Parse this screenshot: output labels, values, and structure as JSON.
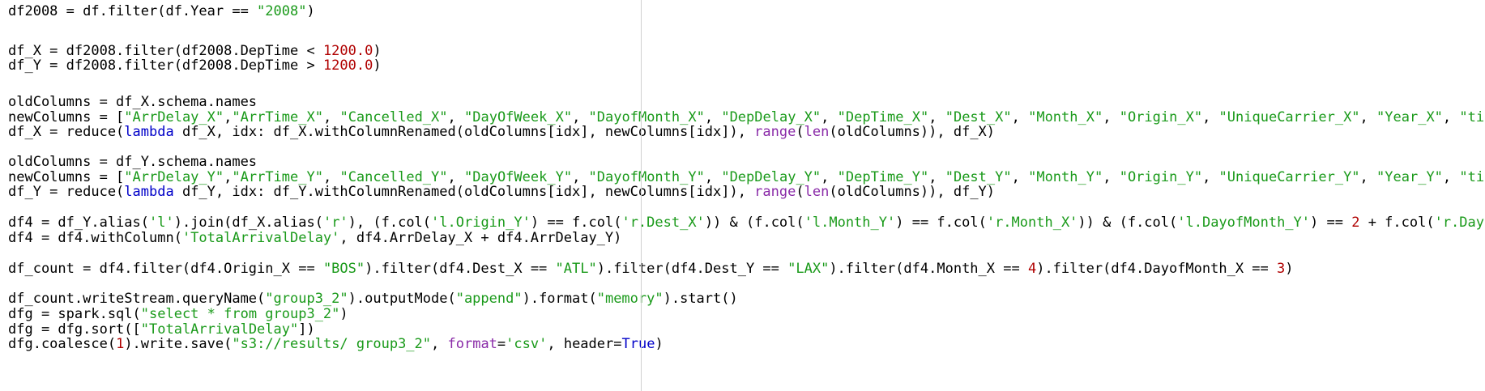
{
  "colors": {
    "plain": "#000000",
    "string": "#1a9a1a",
    "number": "#b00000",
    "keyword": "#0000c8",
    "builtin": "#8a2ba8",
    "background": "#ffffff"
  },
  "lines": [
    {
      "t": [
        [
          "df2008 = df.filter(df.Year == ",
          "plain"
        ],
        [
          "\"2008\"",
          "string"
        ],
        [
          ")",
          "plain"
        ]
      ]
    },
    {
      "t": []
    },
    {
      "t": [
        [
          "df_X = df2008.filter(df2008.DepTime < ",
          "plain"
        ],
        [
          "1200.0",
          "number"
        ],
        [
          ")",
          "plain"
        ]
      ]
    },
    {
      "t": [
        [
          "df_Y = df2008.filter(df2008.DepTime > ",
          "plain"
        ],
        [
          "1200.0",
          "number"
        ],
        [
          ")",
          "plain"
        ]
      ]
    },
    {
      "t": []
    },
    {
      "t": [
        [
          "oldColumns = df_X.schema.names",
          "plain"
        ]
      ]
    },
    {
      "t": [
        [
          "newColumns = [",
          "plain"
        ],
        [
          "\"ArrDelay_X\"",
          "string"
        ],
        [
          ",",
          "plain"
        ],
        [
          "\"ArrTime_X\"",
          "string"
        ],
        [
          ", ",
          "plain"
        ],
        [
          "\"Cancelled_X\"",
          "string"
        ],
        [
          ", ",
          "plain"
        ],
        [
          "\"DayOfWeek_X\"",
          "string"
        ],
        [
          ", ",
          "plain"
        ],
        [
          "\"DayofMonth_X\"",
          "string"
        ],
        [
          ", ",
          "plain"
        ],
        [
          "\"DepDelay_X\"",
          "string"
        ],
        [
          ", ",
          "plain"
        ],
        [
          "\"DepTime_X\"",
          "string"
        ],
        [
          ", ",
          "plain"
        ],
        [
          "\"Dest_X\"",
          "string"
        ],
        [
          ", ",
          "plain"
        ],
        [
          "\"Month_X\"",
          "string"
        ],
        [
          ", ",
          "plain"
        ],
        [
          "\"Origin_X\"",
          "string"
        ],
        [
          ", ",
          "plain"
        ],
        [
          "\"UniqueCarrier_X\"",
          "string"
        ],
        [
          ", ",
          "plain"
        ],
        [
          "\"Year_X\"",
          "string"
        ],
        [
          ", ",
          "plain"
        ],
        [
          "\"timeStam",
          "string"
        ]
      ]
    },
    {
      "t": [
        [
          "df_X = reduce(",
          "plain"
        ],
        [
          "lambda",
          "keyword"
        ],
        [
          " df_X, idx: df_X.withColumnRenamed(oldColumns[idx], newColumns[idx]), ",
          "plain"
        ],
        [
          "range",
          "builtin"
        ],
        [
          "(",
          "plain"
        ],
        [
          "len",
          "builtin"
        ],
        [
          "(oldColumns)), df_X)",
          "plain"
        ]
      ]
    },
    {
      "t": []
    },
    {
      "t": [
        [
          "oldColumns = df_Y.schema.names",
          "plain"
        ]
      ]
    },
    {
      "t": [
        [
          "newColumns = [",
          "plain"
        ],
        [
          "\"ArrDelay_Y\"",
          "string"
        ],
        [
          ",",
          "plain"
        ],
        [
          "\"ArrTime_Y\"",
          "string"
        ],
        [
          ", ",
          "plain"
        ],
        [
          "\"Cancelled_Y\"",
          "string"
        ],
        [
          ", ",
          "plain"
        ],
        [
          "\"DayOfWeek_Y\"",
          "string"
        ],
        [
          ", ",
          "plain"
        ],
        [
          "\"DayofMonth_Y\"",
          "string"
        ],
        [
          ", ",
          "plain"
        ],
        [
          "\"DepDelay_Y\"",
          "string"
        ],
        [
          ", ",
          "plain"
        ],
        [
          "\"DepTime_Y\"",
          "string"
        ],
        [
          ", ",
          "plain"
        ],
        [
          "\"Dest_Y\"",
          "string"
        ],
        [
          ", ",
          "plain"
        ],
        [
          "\"Month_Y\"",
          "string"
        ],
        [
          ", ",
          "plain"
        ],
        [
          "\"Origin_Y\"",
          "string"
        ],
        [
          ", ",
          "plain"
        ],
        [
          "\"UniqueCarrier_Y\"",
          "string"
        ],
        [
          ", ",
          "plain"
        ],
        [
          "\"Year_Y\"",
          "string"
        ],
        [
          ", ",
          "plain"
        ],
        [
          "\"timeStam",
          "string"
        ]
      ]
    },
    {
      "t": [
        [
          "df_Y = reduce(",
          "plain"
        ],
        [
          "lambda",
          "keyword"
        ],
        [
          " df_Y, idx: df_Y.withColumnRenamed(oldColumns[idx], newColumns[idx]), ",
          "plain"
        ],
        [
          "range",
          "builtin"
        ],
        [
          "(",
          "plain"
        ],
        [
          "len",
          "builtin"
        ],
        [
          "(oldColumns)), df_Y)",
          "plain"
        ]
      ]
    },
    {
      "t": []
    },
    {
      "t": [
        [
          "df4 = df_Y.alias(",
          "plain"
        ],
        [
          "'l'",
          "string"
        ],
        [
          ").join(df_X.alias(",
          "plain"
        ],
        [
          "'r'",
          "string"
        ],
        [
          "), (f.col(",
          "plain"
        ],
        [
          "'l.Origin_Y'",
          "string"
        ],
        [
          ") == f.col(",
          "plain"
        ],
        [
          "'r.Dest_X'",
          "string"
        ],
        [
          ")) & (f.col(",
          "plain"
        ],
        [
          "'l.Month_Y'",
          "string"
        ],
        [
          ") == f.col(",
          "plain"
        ],
        [
          "'r.Month_X'",
          "string"
        ],
        [
          ")) & (f.col(",
          "plain"
        ],
        [
          "'l.DayofMonth_Y'",
          "string"
        ],
        [
          ") == ",
          "plain"
        ],
        [
          "2",
          "number"
        ],
        [
          " + f.col(",
          "plain"
        ],
        [
          "'r.DayofMont",
          "string"
        ]
      ]
    },
    {
      "t": [
        [
          "df4 = df4.withColumn(",
          "plain"
        ],
        [
          "'TotalArrivalDelay'",
          "string"
        ],
        [
          ", df4.ArrDelay_X + df4.ArrDelay_Y)",
          "plain"
        ]
      ]
    },
    {
      "t": []
    },
    {
      "t": [
        [
          "df_count = df4.filter(df4.Origin_X == ",
          "plain"
        ],
        [
          "\"BOS\"",
          "string"
        ],
        [
          ").filter(df4.Dest_X == ",
          "plain"
        ],
        [
          "\"ATL\"",
          "string"
        ],
        [
          ").filter(df4.Dest_Y == ",
          "plain"
        ],
        [
          "\"LAX\"",
          "string"
        ],
        [
          ").filter(df4.Month_X == ",
          "plain"
        ],
        [
          "4",
          "number"
        ],
        [
          ").filter(df4.DayofMonth_X == ",
          "plain"
        ],
        [
          "3",
          "number"
        ],
        [
          ")",
          "plain"
        ]
      ]
    },
    {
      "t": []
    },
    {
      "t": [
        [
          "df_count.writeStream.queryName(",
          "plain"
        ],
        [
          "\"group3_2\"",
          "string"
        ],
        [
          ").outputMode(",
          "plain"
        ],
        [
          "\"append\"",
          "string"
        ],
        [
          ").format(",
          "plain"
        ],
        [
          "\"memory\"",
          "string"
        ],
        [
          ").start()",
          "plain"
        ]
      ]
    },
    {
      "t": [
        [
          "dfg = spark.sql(",
          "plain"
        ],
        [
          "\"select * from group3_2\"",
          "string"
        ],
        [
          ")",
          "plain"
        ]
      ]
    },
    {
      "t": [
        [
          "dfg = dfg.sort([",
          "plain"
        ],
        [
          "\"TotalArrivalDelay\"",
          "string"
        ],
        [
          "])",
          "plain"
        ]
      ]
    },
    {
      "t": [
        [
          "dfg.coalesce(",
          "plain"
        ],
        [
          "1",
          "number"
        ],
        [
          ").write.save(",
          "plain"
        ],
        [
          "\"s3://results/ group3_2\"",
          "string"
        ],
        [
          ", ",
          "plain"
        ],
        [
          "format",
          "builtin"
        ],
        [
          "=",
          "plain"
        ],
        [
          "'csv'",
          "string"
        ],
        [
          ", header=",
          "plain"
        ],
        [
          "True",
          "keyword"
        ],
        [
          ")",
          "plain"
        ]
      ]
    }
  ]
}
